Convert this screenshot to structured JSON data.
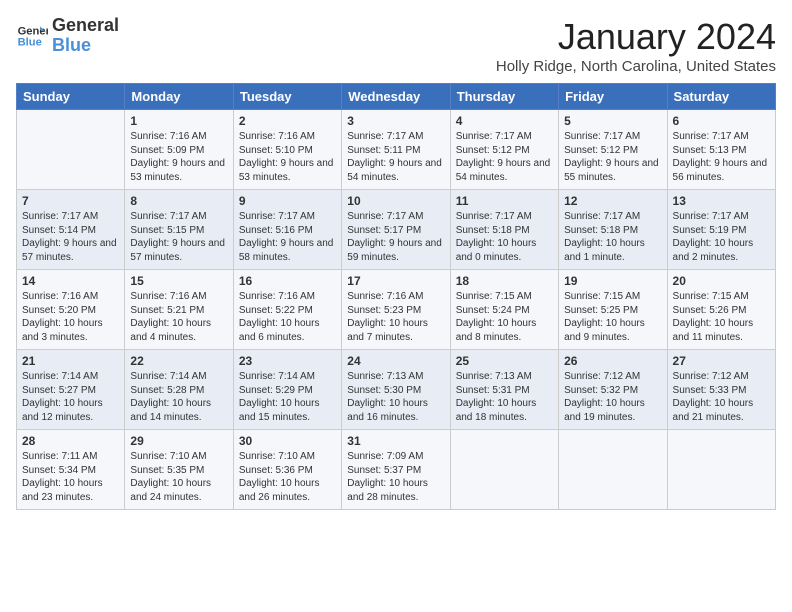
{
  "logo": {
    "line1": "General",
    "line2": "Blue"
  },
  "title": "January 2024",
  "subtitle": "Holly Ridge, North Carolina, United States",
  "days_of_week": [
    "Sunday",
    "Monday",
    "Tuesday",
    "Wednesday",
    "Thursday",
    "Friday",
    "Saturday"
  ],
  "weeks": [
    [
      {
        "day": "",
        "sunrise": "",
        "sunset": "",
        "daylight": ""
      },
      {
        "day": "1",
        "sunrise": "Sunrise: 7:16 AM",
        "sunset": "Sunset: 5:09 PM",
        "daylight": "Daylight: 9 hours and 53 minutes."
      },
      {
        "day": "2",
        "sunrise": "Sunrise: 7:16 AM",
        "sunset": "Sunset: 5:10 PM",
        "daylight": "Daylight: 9 hours and 53 minutes."
      },
      {
        "day": "3",
        "sunrise": "Sunrise: 7:17 AM",
        "sunset": "Sunset: 5:11 PM",
        "daylight": "Daylight: 9 hours and 54 minutes."
      },
      {
        "day": "4",
        "sunrise": "Sunrise: 7:17 AM",
        "sunset": "Sunset: 5:12 PM",
        "daylight": "Daylight: 9 hours and 54 minutes."
      },
      {
        "day": "5",
        "sunrise": "Sunrise: 7:17 AM",
        "sunset": "Sunset: 5:12 PM",
        "daylight": "Daylight: 9 hours and 55 minutes."
      },
      {
        "day": "6",
        "sunrise": "Sunrise: 7:17 AM",
        "sunset": "Sunset: 5:13 PM",
        "daylight": "Daylight: 9 hours and 56 minutes."
      }
    ],
    [
      {
        "day": "7",
        "sunrise": "Sunrise: 7:17 AM",
        "sunset": "Sunset: 5:14 PM",
        "daylight": "Daylight: 9 hours and 57 minutes."
      },
      {
        "day": "8",
        "sunrise": "Sunrise: 7:17 AM",
        "sunset": "Sunset: 5:15 PM",
        "daylight": "Daylight: 9 hours and 57 minutes."
      },
      {
        "day": "9",
        "sunrise": "Sunrise: 7:17 AM",
        "sunset": "Sunset: 5:16 PM",
        "daylight": "Daylight: 9 hours and 58 minutes."
      },
      {
        "day": "10",
        "sunrise": "Sunrise: 7:17 AM",
        "sunset": "Sunset: 5:17 PM",
        "daylight": "Daylight: 9 hours and 59 minutes."
      },
      {
        "day": "11",
        "sunrise": "Sunrise: 7:17 AM",
        "sunset": "Sunset: 5:18 PM",
        "daylight": "Daylight: 10 hours and 0 minutes."
      },
      {
        "day": "12",
        "sunrise": "Sunrise: 7:17 AM",
        "sunset": "Sunset: 5:18 PM",
        "daylight": "Daylight: 10 hours and 1 minute."
      },
      {
        "day": "13",
        "sunrise": "Sunrise: 7:17 AM",
        "sunset": "Sunset: 5:19 PM",
        "daylight": "Daylight: 10 hours and 2 minutes."
      }
    ],
    [
      {
        "day": "14",
        "sunrise": "Sunrise: 7:16 AM",
        "sunset": "Sunset: 5:20 PM",
        "daylight": "Daylight: 10 hours and 3 minutes."
      },
      {
        "day": "15",
        "sunrise": "Sunrise: 7:16 AM",
        "sunset": "Sunset: 5:21 PM",
        "daylight": "Daylight: 10 hours and 4 minutes."
      },
      {
        "day": "16",
        "sunrise": "Sunrise: 7:16 AM",
        "sunset": "Sunset: 5:22 PM",
        "daylight": "Daylight: 10 hours and 6 minutes."
      },
      {
        "day": "17",
        "sunrise": "Sunrise: 7:16 AM",
        "sunset": "Sunset: 5:23 PM",
        "daylight": "Daylight: 10 hours and 7 minutes."
      },
      {
        "day": "18",
        "sunrise": "Sunrise: 7:15 AM",
        "sunset": "Sunset: 5:24 PM",
        "daylight": "Daylight: 10 hours and 8 minutes."
      },
      {
        "day": "19",
        "sunrise": "Sunrise: 7:15 AM",
        "sunset": "Sunset: 5:25 PM",
        "daylight": "Daylight: 10 hours and 9 minutes."
      },
      {
        "day": "20",
        "sunrise": "Sunrise: 7:15 AM",
        "sunset": "Sunset: 5:26 PM",
        "daylight": "Daylight: 10 hours and 11 minutes."
      }
    ],
    [
      {
        "day": "21",
        "sunrise": "Sunrise: 7:14 AM",
        "sunset": "Sunset: 5:27 PM",
        "daylight": "Daylight: 10 hours and 12 minutes."
      },
      {
        "day": "22",
        "sunrise": "Sunrise: 7:14 AM",
        "sunset": "Sunset: 5:28 PM",
        "daylight": "Daylight: 10 hours and 14 minutes."
      },
      {
        "day": "23",
        "sunrise": "Sunrise: 7:14 AM",
        "sunset": "Sunset: 5:29 PM",
        "daylight": "Daylight: 10 hours and 15 minutes."
      },
      {
        "day": "24",
        "sunrise": "Sunrise: 7:13 AM",
        "sunset": "Sunset: 5:30 PM",
        "daylight": "Daylight: 10 hours and 16 minutes."
      },
      {
        "day": "25",
        "sunrise": "Sunrise: 7:13 AM",
        "sunset": "Sunset: 5:31 PM",
        "daylight": "Daylight: 10 hours and 18 minutes."
      },
      {
        "day": "26",
        "sunrise": "Sunrise: 7:12 AM",
        "sunset": "Sunset: 5:32 PM",
        "daylight": "Daylight: 10 hours and 19 minutes."
      },
      {
        "day": "27",
        "sunrise": "Sunrise: 7:12 AM",
        "sunset": "Sunset: 5:33 PM",
        "daylight": "Daylight: 10 hours and 21 minutes."
      }
    ],
    [
      {
        "day": "28",
        "sunrise": "Sunrise: 7:11 AM",
        "sunset": "Sunset: 5:34 PM",
        "daylight": "Daylight: 10 hours and 23 minutes."
      },
      {
        "day": "29",
        "sunrise": "Sunrise: 7:10 AM",
        "sunset": "Sunset: 5:35 PM",
        "daylight": "Daylight: 10 hours and 24 minutes."
      },
      {
        "day": "30",
        "sunrise": "Sunrise: 7:10 AM",
        "sunset": "Sunset: 5:36 PM",
        "daylight": "Daylight: 10 hours and 26 minutes."
      },
      {
        "day": "31",
        "sunrise": "Sunrise: 7:09 AM",
        "sunset": "Sunset: 5:37 PM",
        "daylight": "Daylight: 10 hours and 28 minutes."
      },
      {
        "day": "",
        "sunrise": "",
        "sunset": "",
        "daylight": ""
      },
      {
        "day": "",
        "sunrise": "",
        "sunset": "",
        "daylight": ""
      },
      {
        "day": "",
        "sunrise": "",
        "sunset": "",
        "daylight": ""
      }
    ]
  ]
}
